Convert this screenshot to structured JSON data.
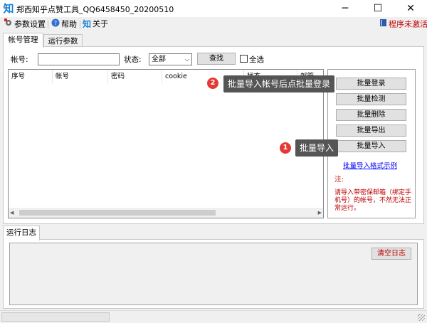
{
  "window": {
    "app_icon": "知",
    "title": "郑西知乎点赞工具_QQ6458450_20200510",
    "controls": [
      "─",
      "☐",
      "✕"
    ]
  },
  "menu": {
    "items": [
      {
        "icon": "gear-icon",
        "label": "参数设置"
      },
      {
        "icon": "help-icon",
        "label": "帮助"
      },
      {
        "icon": "zhi-icon",
        "icon_glyph": "知",
        "label": "关于"
      }
    ],
    "activation": {
      "icon": "book-icon",
      "label": "程序未激活"
    }
  },
  "tabs": [
    "帐号管理",
    "运行参数"
  ],
  "filter": {
    "account_label": "帐号:",
    "account_value": "",
    "status_label": "状态:",
    "status_value": "全部",
    "search_button": "查找",
    "select_all_label": "全选"
  },
  "grid": {
    "columns": [
      "序号",
      "帐号",
      "密码",
      "cookie",
      "状态",
      "邮箱"
    ]
  },
  "side_panel": {
    "buttons": [
      "批量登录",
      "批量检测",
      "批量删除",
      "批量导出",
      "批量导入"
    ],
    "link": "批量导入格式示例",
    "note_label": "注:",
    "warning": "请导入带密保邮箱（绑定手机号）的帐号，不然无法正常运行。"
  },
  "log": {
    "tab": "运行日志",
    "clear_button": "清空日志"
  },
  "callouts": [
    {
      "number": "2",
      "text": "批量导入帐号后点批量登录"
    },
    {
      "number": "1",
      "text": "批量导入"
    }
  ],
  "colors": {
    "accent_red": "#c00000",
    "link_blue": "#0000ff",
    "callout_bg": "#555555",
    "badge_red": "#e53935"
  }
}
